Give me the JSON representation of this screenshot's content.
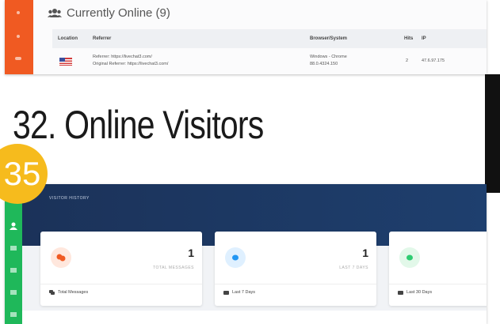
{
  "top_panel": {
    "title": "Currently Online (9)",
    "columns": [
      "Location",
      "Referrer",
      "Browser/System",
      "Hits",
      "IP"
    ],
    "row": {
      "referrer": "Referrer: https://livechat3.com/",
      "original_referrer": "Original Referrer: https://livechat3.com/",
      "browser": "Windows - Chrome",
      "browser_version": "88.0.4324.150",
      "hits": "2",
      "ip": "47.6.97.175"
    },
    "accent_color": "#f05a22"
  },
  "slide": {
    "title": "32. Online Visitors",
    "badge": "35"
  },
  "bottom_panel": {
    "header_label": "VISITOR HISTORY",
    "cards": [
      {
        "value": "1",
        "label": "TOTAL MESSAGES",
        "footer": "Total Messages",
        "icon": "chat-icon",
        "color": "#f05a22"
      },
      {
        "value": "1",
        "label": "LAST 7 DAYS",
        "footer": "Last 7 Days",
        "icon": "chat-bubble-icon",
        "color": "#2196f3"
      },
      {
        "value": "",
        "label": "",
        "footer": "Last 30 Days",
        "icon": "chat-bubble-icon",
        "color": "#2ecc71"
      }
    ],
    "sidebar_color": "#1fb85a",
    "header_color": "#1b3259"
  }
}
